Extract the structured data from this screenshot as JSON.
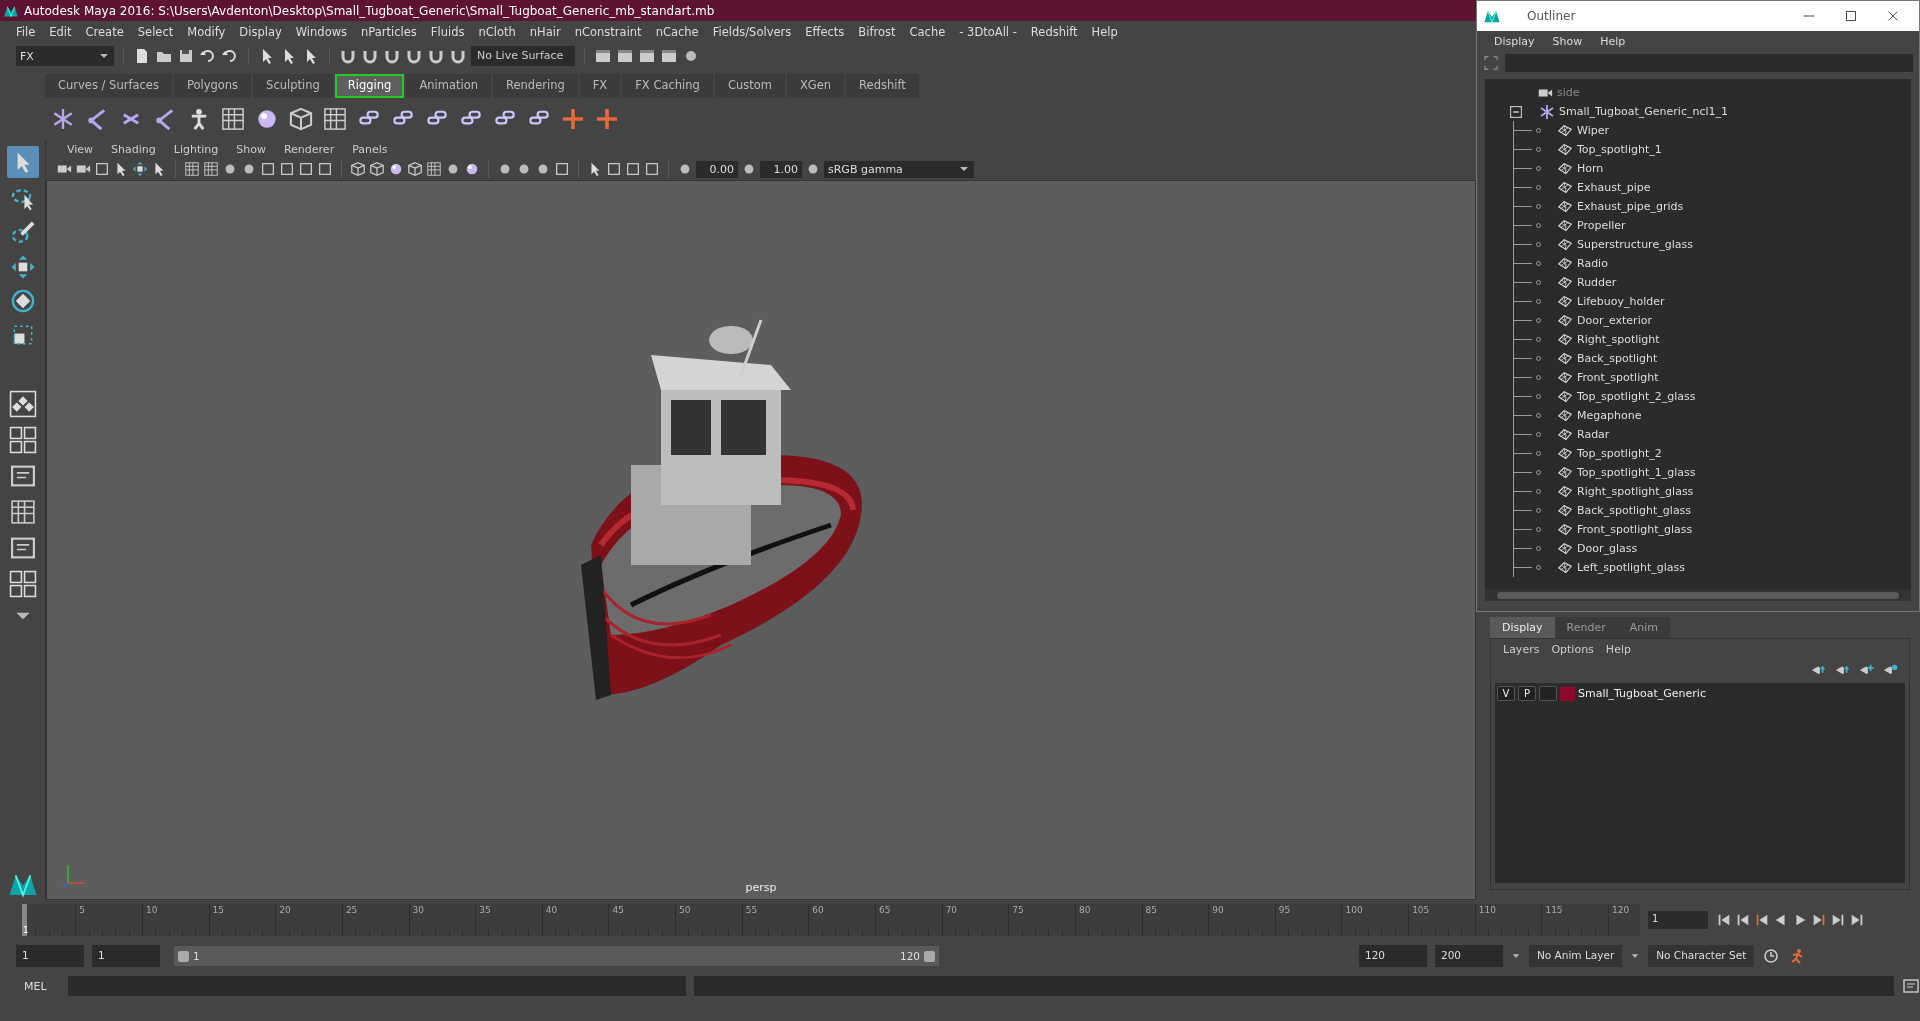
{
  "window": {
    "title": "Autodesk Maya 2016: S:\\Users\\Avdenton\\Desktop\\Small_Tugboat_Generic\\Small_Tugboat_Generic_mb_standart.mb"
  },
  "menu_bar": [
    "File",
    "Edit",
    "Create",
    "Select",
    "Modify",
    "Display",
    "Windows",
    "nParticles",
    "Fluids",
    "nCloth",
    "nHair",
    "nConstraint",
    "nCache",
    "Fields/Solvers",
    "Effects",
    "Bifrost",
    "Cache",
    "- 3DtoAll -",
    "Redshift",
    "Help"
  ],
  "status_line": {
    "menu_set": "FX",
    "live_surface": "No Live Surface"
  },
  "shelf_tabs": [
    {
      "label": "Curves / Surfaces",
      "selected": false
    },
    {
      "label": "Polygons",
      "selected": false
    },
    {
      "label": "Sculpting",
      "selected": false
    },
    {
      "label": "Rigging",
      "selected": true
    },
    {
      "label": "Animation",
      "selected": false
    },
    {
      "label": "Rendering",
      "selected": false
    },
    {
      "label": "FX",
      "selected": false
    },
    {
      "label": "FX Caching",
      "selected": false
    },
    {
      "label": "Custom",
      "selected": false
    },
    {
      "label": "XGen",
      "selected": false
    },
    {
      "label": "Redshift",
      "selected": false
    }
  ],
  "viewport": {
    "menus": [
      "View",
      "Shading",
      "Lighting",
      "Show",
      "Renderer",
      "Panels"
    ],
    "exposure": "0.00",
    "gamma": "1.00",
    "color_space": "sRGB gamma",
    "camera_label": "persp"
  },
  "outliner": {
    "title": "Outliner",
    "menus": [
      "Display",
      "Show",
      "Help"
    ],
    "items": [
      {
        "label": "side",
        "kind": "camera"
      },
      {
        "label": "Small_Tugboat_Generic_ncl1_1",
        "kind": "group",
        "expanded": true,
        "children": [
          {
            "label": "Wiper"
          },
          {
            "label": "Top_spotlight_1"
          },
          {
            "label": "Horn"
          },
          {
            "label": "Exhaust_pipe"
          },
          {
            "label": "Exhaust_pipe_grids"
          },
          {
            "label": "Propeller"
          },
          {
            "label": "Superstructure_glass"
          },
          {
            "label": "Radio"
          },
          {
            "label": "Rudder"
          },
          {
            "label": "Lifebuoy_holder"
          },
          {
            "label": "Door_exterior"
          },
          {
            "label": "Right_spotlight"
          },
          {
            "label": "Back_spotlight"
          },
          {
            "label": "Front_spotlight"
          },
          {
            "label": "Top_spotlight_2_glass"
          },
          {
            "label": "Megaphone"
          },
          {
            "label": "Radar"
          },
          {
            "label": "Top_spotlight_2"
          },
          {
            "label": "Top_spotlight_1_glass"
          },
          {
            "label": "Right_spotlight_glass"
          },
          {
            "label": "Back_spotlight_glass"
          },
          {
            "label": "Front_spotlight_glass"
          },
          {
            "label": "Door_glass"
          },
          {
            "label": "Left_spotlight_glass"
          }
        ]
      }
    ]
  },
  "layer_editor": {
    "tabs": [
      {
        "label": "Display",
        "selected": true
      },
      {
        "label": "Render",
        "selected": false
      },
      {
        "label": "Anim",
        "selected": false
      }
    ],
    "menus": [
      "Layers",
      "Options",
      "Help"
    ],
    "layers": [
      {
        "visible": "V",
        "playback": "P",
        "color": "#8c0a2c",
        "name": "Small_Tugboat_Generic"
      }
    ]
  },
  "timeline": {
    "ticks": [
      "5",
      "10",
      "15",
      "20",
      "25",
      "30",
      "35",
      "40",
      "45",
      "50",
      "55",
      "60",
      "65",
      "70",
      "75",
      "80",
      "85",
      "90",
      "95",
      "100",
      "105",
      "110",
      "115",
      "120"
    ],
    "current_marker": "1",
    "current_frame": "1",
    "level": 0
  },
  "range_slider": {
    "start_frame": "1",
    "range_start_field": "1",
    "range_start": "1",
    "range_end": "120",
    "range_end_field": "120",
    "end_frame": "200",
    "level": 1,
    "anim_layer": "No Anim Layer",
    "character_set": "No Character Set"
  },
  "command_line": {
    "language": "MEL"
  }
}
